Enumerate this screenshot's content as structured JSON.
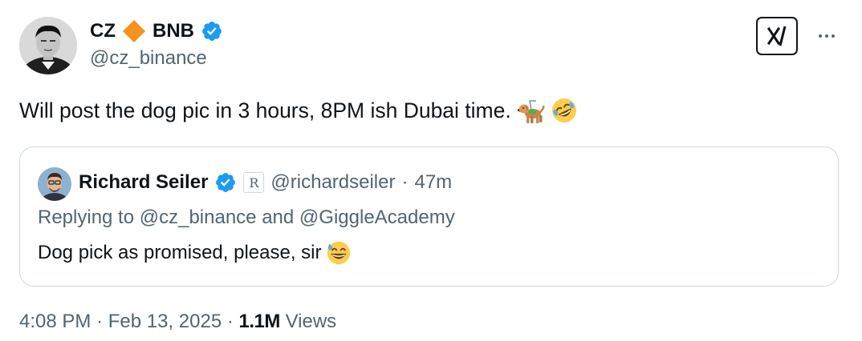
{
  "author": {
    "name_first": "CZ",
    "name_second": "BNB",
    "handle": "@cz_binance"
  },
  "tweet": {
    "text": "Will post the dog pic in 3 hours, 8PM ish Dubai time.",
    "emojis": [
      "guide-dog",
      "rolling-on-floor-laughing"
    ]
  },
  "quote": {
    "author_name": "Richard Seiler",
    "affiliate_badge": "R",
    "handle": "@richardseiler",
    "separator": "·",
    "time_ago": "47m",
    "replying_label": "Replying to",
    "replying_user_1": "@cz_binance",
    "replying_and": "and",
    "replying_user_2": "@GiggleAcademy",
    "text": "Dog pick as promised, please, sir",
    "emoji": "grinning-face-with-sweat"
  },
  "footer": {
    "time": "4:08 PM",
    "sep1": "·",
    "date": "Feb 13, 2025",
    "sep2": "·",
    "views_count": "1.1M",
    "views_label": "Views"
  },
  "colors": {
    "text": "#0f1419",
    "secondary": "#536471",
    "verified": "#1d9bf0",
    "border": "#cfd9de",
    "diamond": "#f6921e"
  },
  "icons": {
    "grok": "grok-icon",
    "more": "more-icon",
    "verified": "verified-badge-icon",
    "diamond": "orange-diamond-icon"
  }
}
